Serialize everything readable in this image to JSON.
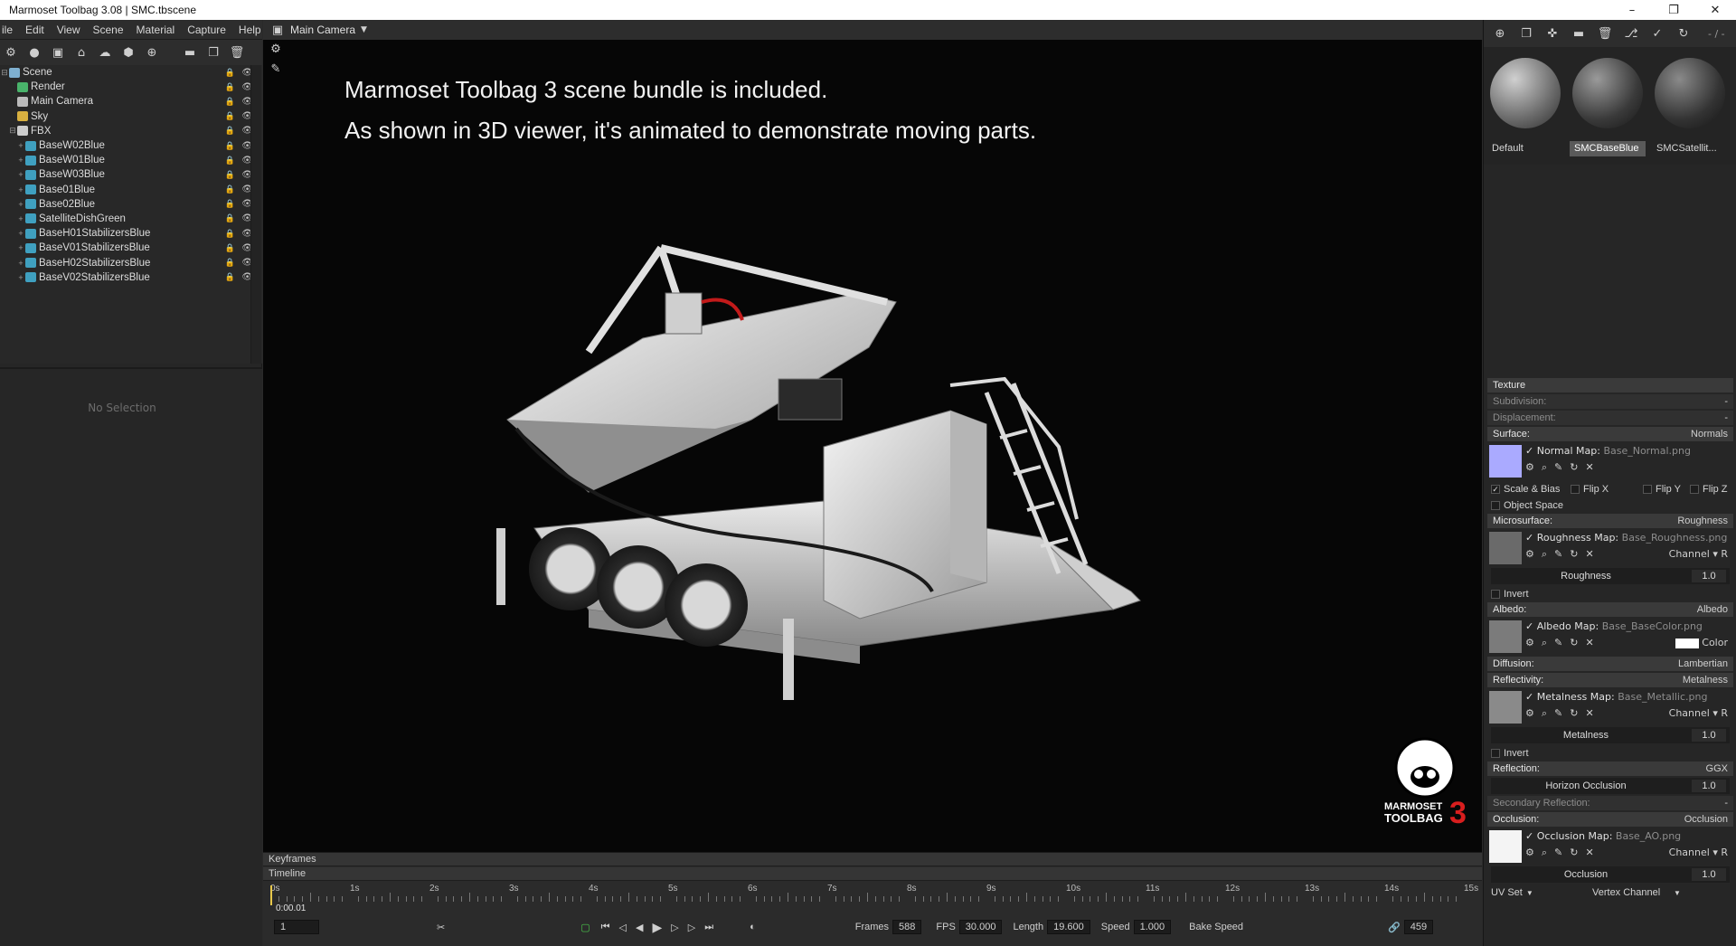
{
  "app": {
    "title": "Marmoset Toolbag 3.08 | SMC.tbscene",
    "minimize": "–",
    "restore": "❐",
    "close": "✕"
  },
  "menu": [
    "ile",
    "Edit",
    "View",
    "Scene",
    "Material",
    "Capture",
    "Help"
  ],
  "scene_tree": [
    {
      "label": "Scene",
      "indent": 0,
      "icon_color": "#7fb0d0",
      "expander": "⊟"
    },
    {
      "label": "Render",
      "indent": 1,
      "icon_color": "#49b36b",
      "expander": ""
    },
    {
      "label": "Main Camera",
      "indent": 1,
      "icon_color": "#bbbbbb",
      "expander": ""
    },
    {
      "label": "Sky",
      "indent": 1,
      "icon_color": "#d8b040",
      "expander": ""
    },
    {
      "label": "FBX",
      "indent": 1,
      "icon_color": "#cccccc",
      "expander": "⊟"
    },
    {
      "label": "BaseW02Blue",
      "indent": 2,
      "icon_color": "#3fa0c0",
      "expander": "+"
    },
    {
      "label": "BaseW01Blue",
      "indent": 2,
      "icon_color": "#3fa0c0",
      "expander": "+"
    },
    {
      "label": "BaseW03Blue",
      "indent": 2,
      "icon_color": "#3fa0c0",
      "expander": "+"
    },
    {
      "label": "Base01Blue",
      "indent": 2,
      "icon_color": "#3fa0c0",
      "expander": "+"
    },
    {
      "label": "Base02Blue",
      "indent": 2,
      "icon_color": "#3fa0c0",
      "expander": "+"
    },
    {
      "label": "SatelliteDishGreen",
      "indent": 2,
      "icon_color": "#3fa0c0",
      "expander": "+"
    },
    {
      "label": "BaseH01StabilizersBlue",
      "indent": 2,
      "icon_color": "#3fa0c0",
      "expander": "+"
    },
    {
      "label": "BaseV01StabilizersBlue",
      "indent": 2,
      "icon_color": "#3fa0c0",
      "expander": "+"
    },
    {
      "label": "BaseH02StabilizersBlue",
      "indent": 2,
      "icon_color": "#3fa0c0",
      "expander": "+"
    },
    {
      "label": "BaseV02StabilizersBlue",
      "indent": 2,
      "icon_color": "#3fa0c0",
      "expander": "+"
    }
  ],
  "no_selection": "No Selection",
  "viewport": {
    "camera": "Main Camera",
    "caption1": "Marmoset Toolbag 3 scene bundle is included.",
    "caption2": "As shown in 3D viewer, it's animated to demonstrate moving parts.",
    "logo_line1": "MARMOSET",
    "logo_line2": "TOOLBAG",
    "logo_num": "3"
  },
  "timeline": {
    "keyframes": "Keyframes",
    "timeline": "Timeline",
    "ticks": [
      "0s",
      "1s",
      "2s",
      "3s",
      "4s",
      "5s",
      "6s",
      "7s",
      "8s",
      "9s",
      "10s",
      "11s",
      "12s",
      "13s",
      "14s",
      "15s"
    ],
    "current_time": "0:00.01",
    "frame": "1",
    "frames_label": "Frames",
    "frames": "588",
    "fps_label": "FPS",
    "fps": "30.000",
    "length_label": "Length",
    "length": "19.600",
    "speed_label": "Speed",
    "speed": "1.000",
    "bake_speed": "Bake Speed",
    "count": "459"
  },
  "materials": {
    "ratio": "- / -",
    "items": [
      {
        "name": "Default",
        "selected": false
      },
      {
        "name": "SMCBaseBlue",
        "selected": true
      },
      {
        "name": "SMCSatellit...",
        "selected": false
      }
    ]
  },
  "props": {
    "texture": "Texture",
    "subdivision": "Subdivision:",
    "subdivision_val": "-",
    "displacement": "Displacement:",
    "displacement_val": "-",
    "surface": "Surface:",
    "surface_val": "Normals",
    "normal_map_label": "Normal Map:",
    "normal_map_file": "Base_Normal.png",
    "scale_bias": "Scale & Bias",
    "flip_x": "Flip X",
    "flip_y": "Flip Y",
    "flip_z": "Flip Z",
    "object_space": "Object Space",
    "microsurface": "Microsurface:",
    "microsurface_val": "Roughness",
    "roughness_map_label": "Roughness Map:",
    "roughness_map_file": "Base_Roughness.png",
    "channel": "Channel",
    "channel_r": "R",
    "roughness": "Roughness",
    "roughness_val": "1.0",
    "invert": "Invert",
    "albedo": "Albedo:",
    "albedo_val": "Albedo",
    "albedo_map_label": "Albedo Map:",
    "albedo_map_file": "Base_BaseColor.png",
    "color": "Color",
    "diffusion": "Diffusion:",
    "diffusion_val": "Lambertian",
    "reflectivity": "Reflectivity:",
    "reflectivity_val": "Metalness",
    "metalness_map_label": "Metalness Map:",
    "metalness_map_file": "Base_Metallic.png",
    "metalness": "Metalness",
    "metalness_val": "1.0",
    "reflection": "Reflection:",
    "reflection_val": "GGX",
    "horizon_occlusion": "Horizon Occlusion",
    "horizon_val": "1.0",
    "secondary_reflection": "Secondary Reflection:",
    "secondary_val": "-",
    "occlusion": "Occlusion:",
    "occlusion_val": "Occlusion",
    "occlusion_map_label": "Occlusion Map:",
    "occlusion_map_file": "Base_AO.png",
    "occlusion_slider": "Occlusion",
    "occlusion_slider_val": "1.0",
    "uv_set": "UV Set",
    "vertex_channel": "Vertex Channel"
  },
  "colors": {
    "normal_swatch": "#aaaaff",
    "accent": "#4a90d0"
  }
}
